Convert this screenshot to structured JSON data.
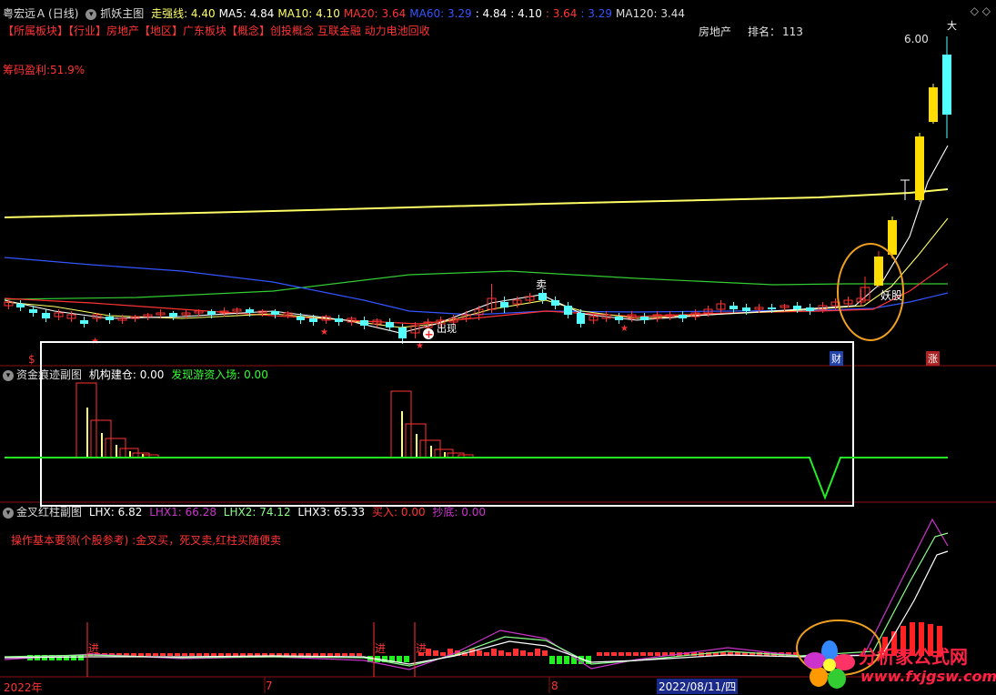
{
  "header": {
    "stock": "粤宏远Ａ",
    "period": "(日线)",
    "indicator": "抓妖主图",
    "items": [
      {
        "label": "走强线: ",
        "value": "4.40",
        "color": "#ffff66"
      },
      {
        "label": "MA5: ",
        "value": "4.84",
        "color": "#ffffff"
      },
      {
        "label": "MA10: ",
        "value": "4.10",
        "color": "#ffff66"
      },
      {
        "label": "MA20: ",
        "value": "3.64",
        "color": "#ff3333"
      },
      {
        "label": "MA60: ",
        "value": "3.29",
        "color": "#3355ff"
      },
      {
        "label": ": ",
        "value": "4.84",
        "color": "#ffffff"
      },
      {
        "label": ": ",
        "value": "4.10",
        "color": "#ffffff"
      },
      {
        "label": ": ",
        "value": "3.64",
        "color": "#ff3333"
      },
      {
        "label": ": ",
        "value": "3.29",
        "color": "#3355ff"
      },
      {
        "label": "MA120: ",
        "value": "3.44",
        "color": "#dddddd"
      }
    ]
  },
  "sector_line": "【所属板块】【行业】房地产【地区】广东板块【概念】创投概念 互联金融 动力电池回收",
  "industry": "房地产",
  "rank_label": "排名：",
  "rank_value": "113",
  "chip_profit": "筹码盈利:51.9%",
  "price_high": "6.00",
  "marks": {
    "sell": "卖",
    "yaogu": "妖股",
    "finance": "财",
    "zhang": "涨",
    "dollar": "$",
    "chuxian": "出现",
    "top_mark": "大"
  },
  "panel2": {
    "title": "资金痕迹副图",
    "jigou_label": "机构建仓: ",
    "jigou_value": "0.00",
    "youzi_label": "发现游资入场: ",
    "youzi_value": "0.00"
  },
  "panel3": {
    "title": "金叉红柱副图",
    "lhx_label": "LHX: ",
    "lhx_value": "6.82",
    "lhx1_label": "LHX1: ",
    "lhx1_value": "66.28",
    "lhx2_label": "LHX2: ",
    "lhx2_value": "74.12",
    "lhx3_label": "LHX3: ",
    "lhx3_value": "65.33",
    "buy_label": "买入: ",
    "buy_value": "0.00",
    "dip_label": "抄底: ",
    "dip_value": "0.00",
    "note": "操作基本要领(个股参考) :金叉买，死叉卖,红柱买随便卖",
    "jin": "进"
  },
  "timeline": {
    "year": "2022年",
    "m7": "7",
    "m8": "8",
    "cursor_date": "2022/08/11/四"
  },
  "watermark": {
    "cn": "分析家公式网",
    "url": "www.fxjgsw.com"
  },
  "colors": {
    "up": "#ff3333",
    "down": "#54ffff",
    "ma5": "#ffffff",
    "ma10": "#ffff66",
    "ma20": "#ff3333",
    "ma60": "#3355ff",
    "ma120": "#33cc33",
    "strong": "#ffff66"
  }
}
